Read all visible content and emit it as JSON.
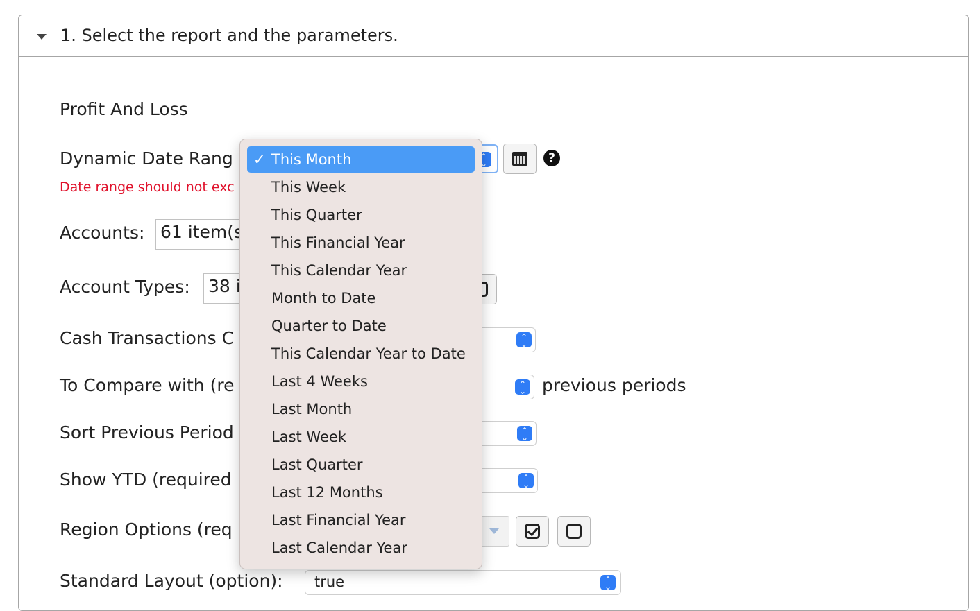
{
  "panel": {
    "title": "1. Select the report and the parameters."
  },
  "report": {
    "name": "Profit And Loss"
  },
  "fields": {
    "dynamic_date_label": "Dynamic Date Rang",
    "date_error": "Date range should not exc",
    "accounts_label": "Accounts:",
    "accounts_value": "61 item(s",
    "account_types_label": "Account Types:",
    "account_types_value": "38 i",
    "cash_label": "Cash Transactions C",
    "compare_label": "To Compare with (re",
    "compare_suffix": "previous periods",
    "sort_label": "Sort Previous Period",
    "ytd_label": "Show YTD (required",
    "region_label": "Region Options (req",
    "layout_label": "Standard Layout (option):",
    "layout_value": "true"
  },
  "dropdown": {
    "selected": "This Month",
    "check": "✓",
    "options": [
      "This Month",
      "This Week",
      "This Quarter",
      "This Financial Year",
      "This Calendar Year",
      "Month to Date",
      "Quarter to Date",
      "This Calendar Year to Date",
      "Last 4 Weeks",
      "Last Month",
      "Last Week",
      "Last Quarter",
      "Last 12 Months",
      "Last Financial Year",
      "Last Calendar Year"
    ]
  },
  "icons": {
    "panel_caret": "caret-down-icon",
    "calendar": "calendar-icon",
    "help": "question-circle-icon",
    "select_all": "check-square-icon",
    "select_none": "empty-square-icon"
  },
  "colors": {
    "error": "#e0112b",
    "selection": "#4a9bf6",
    "stepper": "#2f7cf6",
    "dropdown_bg": "#ede4e2"
  },
  "help_glyph": "?"
}
